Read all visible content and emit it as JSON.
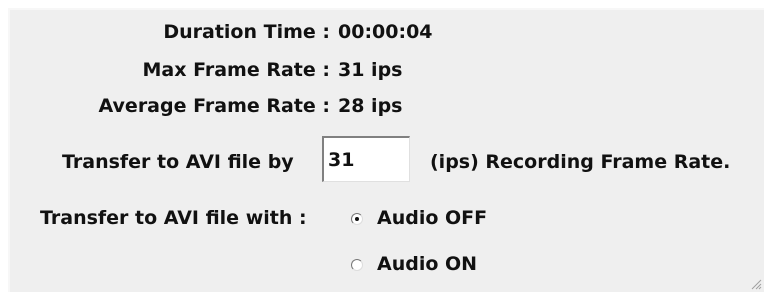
{
  "stats": {
    "duration_label": "Duration Time :",
    "duration_value": "00:00:04",
    "max_rate_label": "Max Frame Rate :",
    "max_rate_value": "31 ips",
    "avg_rate_label": "Average Frame Rate :",
    "avg_rate_value": "28 ips"
  },
  "transfer": {
    "by_label": "Transfer to AVI file by",
    "frame_rate_value": "31",
    "suffix_label": "(ips) Recording Frame Rate."
  },
  "audio": {
    "with_label": "Transfer to AVI file with :",
    "off_label": "Audio OFF",
    "on_label": "Audio ON",
    "selected": "off"
  }
}
